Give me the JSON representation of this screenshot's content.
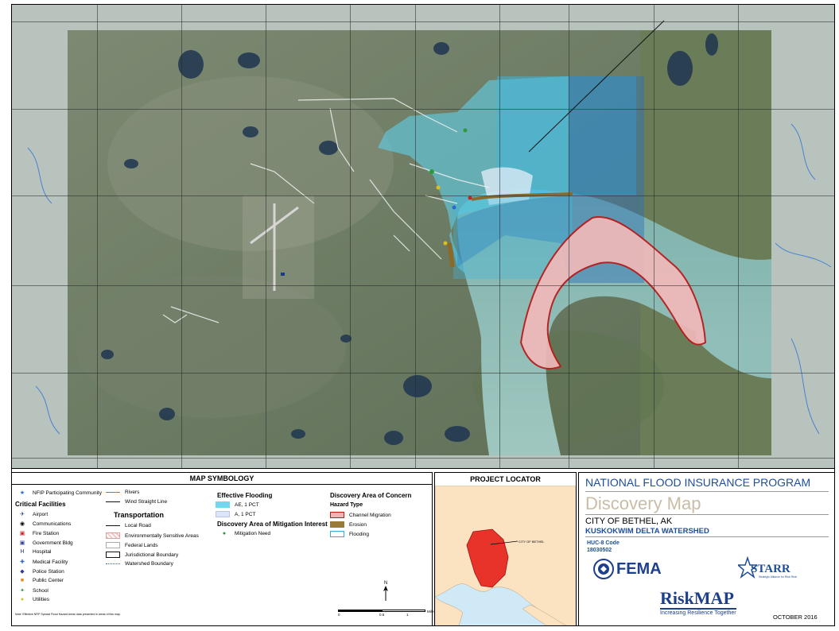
{
  "symbology": {
    "header": "MAP SYMBOLOGY",
    "nfip": "NFIP Participating Community",
    "critical_title": "Critical Facilities",
    "critical": [
      {
        "label": "Airport",
        "icon": "airport-icon",
        "glyph": "✈",
        "color": "#1a3a8a"
      },
      {
        "label": "Communications",
        "icon": "communications-icon",
        "glyph": "◉",
        "color": "#000000"
      },
      {
        "label": "Fire Station",
        "icon": "fire-station-icon",
        "glyph": "▣",
        "color": "#d02020"
      },
      {
        "label": "Government Bldg",
        "icon": "government-icon",
        "glyph": "▣",
        "color": "#2c3f9a"
      },
      {
        "label": "Hospital",
        "icon": "hospital-icon",
        "glyph": "H",
        "color": "#1a3a8a"
      },
      {
        "label": "Medical Facility",
        "icon": "medical-icon",
        "glyph": "✚",
        "color": "#2a6acc"
      },
      {
        "label": "Police Station",
        "icon": "police-icon",
        "glyph": "◆",
        "color": "#2a3ba0"
      },
      {
        "label": "Public Center",
        "icon": "public-center-icon",
        "glyph": "■",
        "color": "#e08a20"
      },
      {
        "label": "School",
        "icon": "school-icon",
        "glyph": "✦",
        "color": "#2a9a3a"
      },
      {
        "label": "Utilities",
        "icon": "utilities-icon",
        "glyph": "●",
        "color": "#d8c020"
      }
    ],
    "rivers": "Rivers",
    "wind_line": "Wind Straight Line",
    "transport_title": "Transportation",
    "local_road": "Local Road",
    "env_sensitive": "Environmentally Sensitive Areas",
    "federal_lands": "Federal Lands",
    "jurisdictional": "Jurisdictional Boundary",
    "watershed": "Watershed Boundary",
    "effective_title": "Effective Flooding",
    "ae_label": "AE, 1 PCT",
    "a_label": "A, 1 PCT",
    "mitigation_title": "Discovery Area of Mitigation Interest",
    "mitigation_need": "Mitigation Need",
    "concern_title": "Discovery Area of Concern",
    "hazard_type": "Hazard Type",
    "channel_migration": "Channel Migration",
    "erosion": "Erosion",
    "flooding": "Flooding",
    "footnote": "Note: Effective NFIP Special Flood Hazard Areas data presented in areas of this map.",
    "colors": {
      "ae": "#6fd8f0",
      "a": "#dde6f8",
      "channel": "#f0b4b4",
      "channel_border": "#b81a1a",
      "erosion": "#9a7a38",
      "flooding_border": "#39a6d8",
      "rivers": "#3b8fc8",
      "env": "#f6c4c4"
    }
  },
  "scale": {
    "ticks": [
      "0",
      "0.5",
      "1",
      "Miles"
    ],
    "north": "N"
  },
  "locator": {
    "header": "PROJECT LOCATOR",
    "label": "CITY OF BETHEL"
  },
  "title_block": {
    "program": "NATIONAL FLOOD INSURANCE PROGRAM",
    "map_title": "Discovery Map",
    "city": "CITY OF BETHEL, AK",
    "watershed": "KUSKOKWIM DELTA WATERSHED",
    "huc_label": "HUC-8 Code",
    "huc_code": "18030502",
    "fema": "FEMA",
    "starr": "STARR",
    "starr_sub": "Strategic Alliance for Risk Reduction",
    "riskmap": "RiskMAP",
    "tagline": "Increasing Resilience Together",
    "date": "OCTOBER 2016"
  }
}
